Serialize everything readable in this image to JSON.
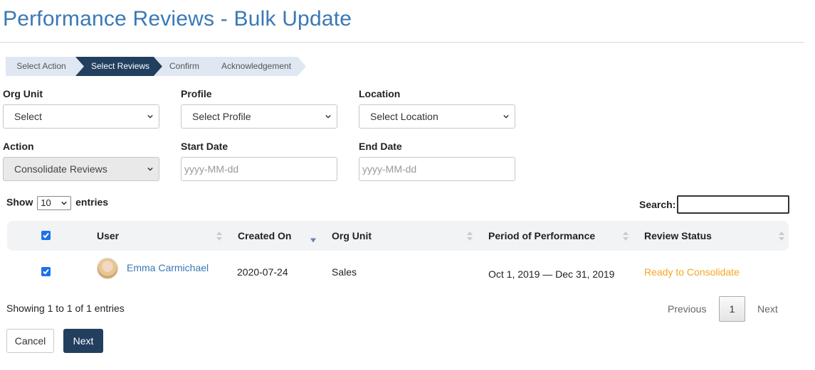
{
  "page": {
    "title": "Performance Reviews - Bulk Update"
  },
  "wizard": {
    "steps": [
      {
        "label": "Select Action",
        "active": false
      },
      {
        "label": "Select Reviews",
        "active": true
      },
      {
        "label": "Confirm",
        "active": false
      },
      {
        "label": "Acknowledgement",
        "active": false
      }
    ]
  },
  "filters": {
    "org_unit": {
      "label": "Org Unit",
      "value": "Select"
    },
    "profile": {
      "label": "Profile",
      "value": "Select Profile"
    },
    "location": {
      "label": "Location",
      "value": "Select Location"
    },
    "action": {
      "label": "Action",
      "value": "Consolidate Reviews"
    },
    "start_date": {
      "label": "Start Date",
      "placeholder": "yyyy-MM-dd"
    },
    "end_date": {
      "label": "End Date",
      "placeholder": "yyyy-MM-dd"
    }
  },
  "table_controls": {
    "show_label": "Show",
    "entries_value": "10",
    "entries_label": "entries",
    "search_label": "Search:"
  },
  "table": {
    "columns": [
      "User",
      "Created On",
      "Org Unit",
      "Period of Performance",
      "Review Status"
    ],
    "rows": [
      {
        "checked": true,
        "user": "Emma Carmichael",
        "created_on": "2020-07-24",
        "org_unit": "Sales",
        "period": "Oct 1, 2019 — Dec 31, 2019",
        "status": "Ready to Consolidate"
      }
    ]
  },
  "pagination": {
    "info": "Showing 1 to 1 of 1 entries",
    "previous": "Previous",
    "current_page": "1",
    "next": "Next"
  },
  "actions": {
    "cancel": "Cancel",
    "next": "Next"
  },
  "colors": {
    "title": "#3a78b5",
    "active_step": "#223f5f",
    "inactive_step": "#dfe7f3",
    "status": "#f5a623",
    "primary_button": "#223f5f"
  }
}
